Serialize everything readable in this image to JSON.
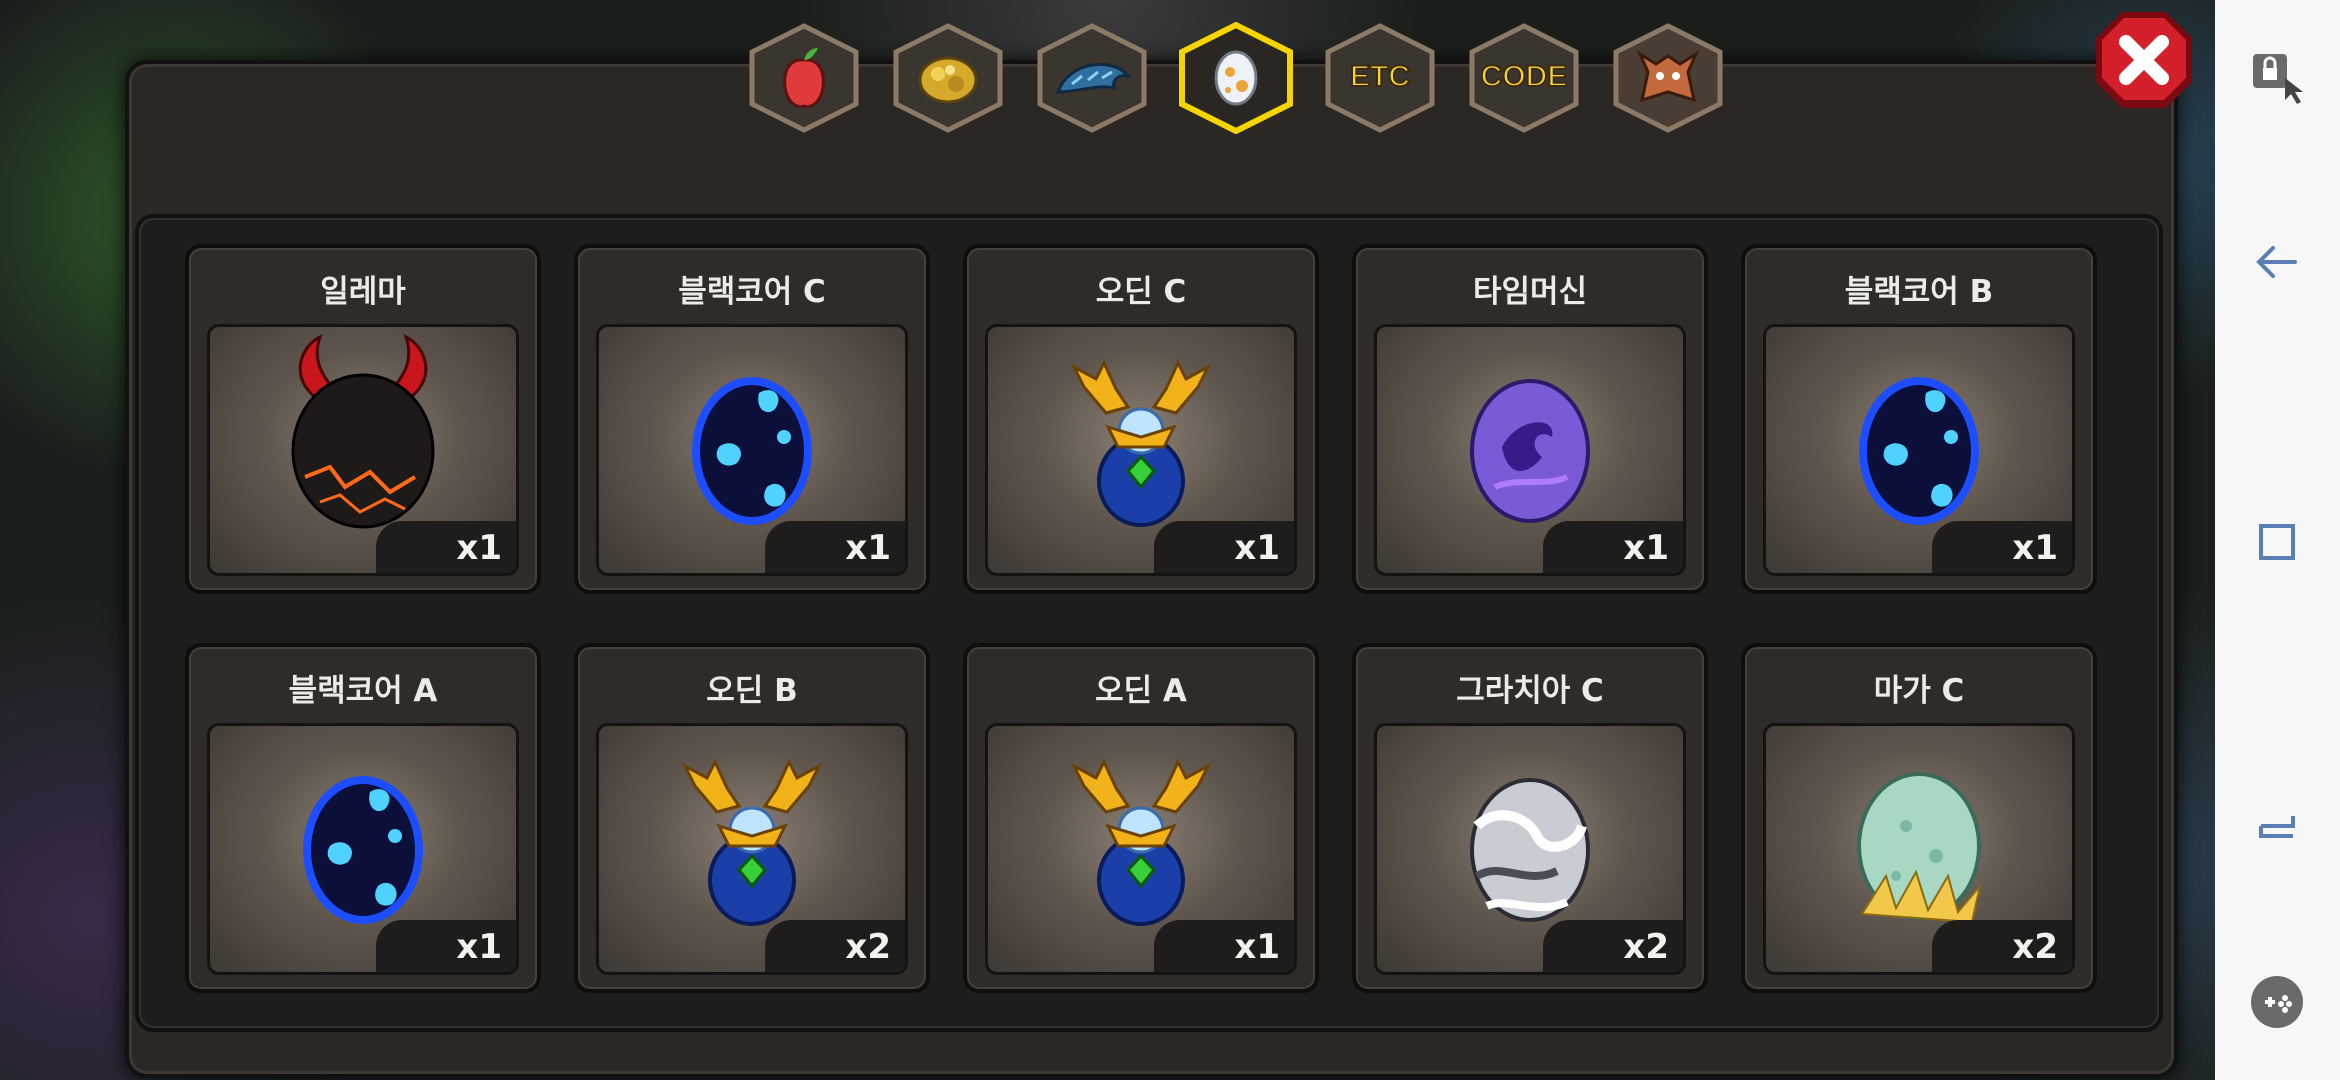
{
  "tabs": [
    {
      "id": "fruit",
      "icon": "fruit-icon",
      "label": ""
    },
    {
      "id": "ore",
      "icon": "gold-ore-icon",
      "label": ""
    },
    {
      "id": "dragon",
      "icon": "dragon-scale-icon",
      "label": ""
    },
    {
      "id": "egg",
      "icon": "egg-icon",
      "label": "",
      "active": true
    },
    {
      "id": "etc",
      "icon": "",
      "label": "ETC"
    },
    {
      "id": "code",
      "icon": "",
      "label": "CODE"
    },
    {
      "id": "monster",
      "icon": "monster-head-icon",
      "label": ""
    }
  ],
  "items": [
    {
      "name": "일레마",
      "qty": "x1",
      "egg": "demon"
    },
    {
      "name": "블랙코어 C",
      "qty": "x1",
      "egg": "blackcore"
    },
    {
      "name": "오딘 C",
      "qty": "x1",
      "egg": "odin"
    },
    {
      "name": "타임머신",
      "qty": "x1",
      "egg": "timemachine"
    },
    {
      "name": "블랙코어 B",
      "qty": "x1",
      "egg": "blackcore"
    },
    {
      "name": "블랙코어 A",
      "qty": "x1",
      "egg": "blackcore"
    },
    {
      "name": "오딘 B",
      "qty": "x2",
      "egg": "odin"
    },
    {
      "name": "오딘 A",
      "qty": "x1",
      "egg": "odin"
    },
    {
      "name": "그라치아 C",
      "qty": "x2",
      "egg": "gracia"
    },
    {
      "name": "마가 C",
      "qty": "x2",
      "egg": "maga"
    }
  ],
  "colors": {
    "tab_active_border": "#f5d400",
    "tab_border": "#8a7a66",
    "close_red": "#d4202a",
    "nav_icon": "#5a7fb5"
  },
  "system_nav": [
    {
      "icon": "touch-lock-icon"
    },
    {
      "icon": "back-arrow-icon"
    },
    {
      "icon": "recents-square-icon"
    },
    {
      "icon": "switch-apps-icon"
    },
    {
      "icon": "gamepad-icon"
    }
  ]
}
